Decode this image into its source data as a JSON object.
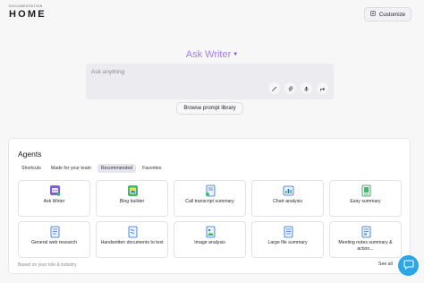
{
  "header": {
    "section_label": "DOCUMENTATION",
    "title": "HOME",
    "customize_label": "Customize"
  },
  "ask": {
    "title": "Ask Writer",
    "placeholder": "Ask anything",
    "browse_label": "Browse prompt library"
  },
  "agents": {
    "title": "Agents",
    "tabs": [
      {
        "label": "Shortcuts",
        "active": false
      },
      {
        "label": "Made for your team",
        "active": false
      },
      {
        "label": "Recommended",
        "active": true
      },
      {
        "label": "Favorites",
        "active": false
      }
    ],
    "cards": [
      {
        "label": "Ask Writer",
        "icon": "writer-bot-icon"
      },
      {
        "label": "Blog builder",
        "icon": "blog-builder-icon"
      },
      {
        "label": "Call transcript summary",
        "icon": "call-transcript-icon"
      },
      {
        "label": "Chart analysis",
        "icon": "chart-analysis-icon"
      },
      {
        "label": "Easy summary",
        "icon": "easy-summary-icon"
      },
      {
        "label": "General web research",
        "icon": "web-research-icon"
      },
      {
        "label": "Handwritten documents to text",
        "icon": "handwritten-doc-icon"
      },
      {
        "label": "Image analysis",
        "icon": "image-analysis-icon"
      },
      {
        "label": "Large file summary",
        "icon": "large-file-icon"
      },
      {
        "label": "Meeting notes summary & action...",
        "icon": "meeting-notes-icon"
      }
    ],
    "footer_note": "Based on your role & industry",
    "see_all": "See all"
  },
  "colors": {
    "accent": "#a47de6",
    "chat_fab": "#2aa7e4"
  }
}
